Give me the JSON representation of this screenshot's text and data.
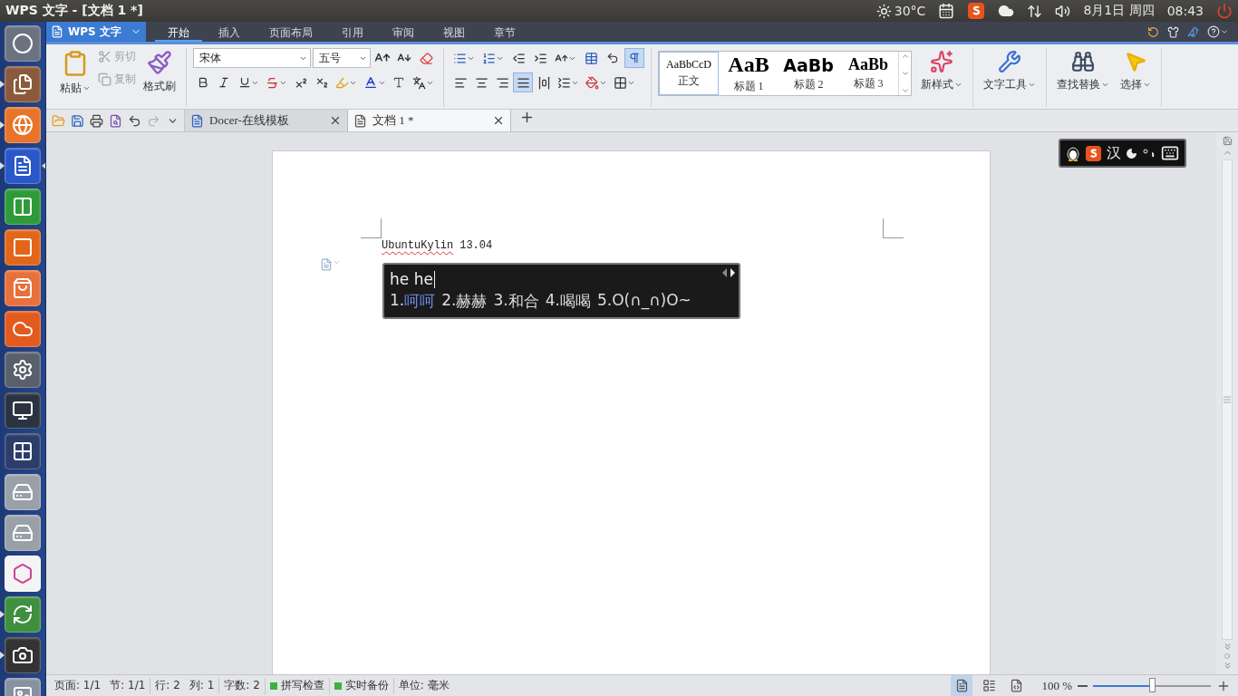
{
  "top_panel": {
    "title": "WPS 文字 - [文档 1 *]",
    "temperature": "30°C",
    "date": "8月1日 周四",
    "time": "08:43"
  },
  "launcher": {
    "items": [
      {
        "kind": "dash",
        "running": false
      },
      {
        "kind": "files",
        "running": true
      },
      {
        "kind": "browser",
        "running": true
      },
      {
        "kind": "writer",
        "running": true,
        "selected": true
      },
      {
        "kind": "spreadsheet",
        "running": false
      },
      {
        "kind": "presentation",
        "running": false
      },
      {
        "kind": "store",
        "running": false
      },
      {
        "kind": "cloud",
        "running": false
      },
      {
        "kind": "settings",
        "running": false
      },
      {
        "kind": "monitor",
        "running": false
      },
      {
        "kind": "workspaces",
        "running": false
      },
      {
        "kind": "disk",
        "running": false
      },
      {
        "kind": "disk",
        "running": false
      },
      {
        "kind": "palette",
        "running": false
      },
      {
        "kind": "updater",
        "running": true
      },
      {
        "kind": "webcam",
        "running": true
      },
      {
        "kind": "screenshot",
        "running": false
      }
    ]
  },
  "app_menu": {
    "label": "WPS 文字",
    "tabs": [
      {
        "label": "开始",
        "selected": true
      },
      {
        "label": "插入",
        "selected": false
      },
      {
        "label": "页面布局",
        "selected": false
      },
      {
        "label": "引用",
        "selected": false
      },
      {
        "label": "审阅",
        "selected": false
      },
      {
        "label": "视图",
        "selected": false
      },
      {
        "label": "章节",
        "selected": false
      }
    ]
  },
  "ribbon": {
    "paste": "粘贴",
    "cut": {
      "label": "剪切",
      "disabled": true
    },
    "copy": {
      "label": "复制",
      "disabled": true
    },
    "format_painter": "格式刷",
    "font_family": "宋体",
    "font_size": "五号",
    "show_marks": true,
    "alignments": [
      {
        "kind": "left",
        "selected": false
      },
      {
        "kind": "center",
        "selected": false
      },
      {
        "kind": "right",
        "selected": false
      },
      {
        "kind": "justify",
        "selected": true
      },
      {
        "kind": "distribute",
        "selected": false
      }
    ],
    "styles": [
      {
        "sample": "AaBbCcD",
        "name": "正文",
        "kind": "body",
        "selected": true
      },
      {
        "sample": "AaB",
        "name": "标题 1",
        "kind": "h1",
        "selected": false
      },
      {
        "sample": "AaBb",
        "name": "标题 2",
        "kind": "h2",
        "selected": false
      },
      {
        "sample": "AaBb",
        "name": "标题 3",
        "kind": "h3",
        "selected": false
      }
    ],
    "new_style": "新样式",
    "text_tools": "文字工具",
    "find_replace": "查找替换",
    "select": "选择"
  },
  "quick_access": [
    {
      "kind": "open",
      "disabled": false
    },
    {
      "kind": "save",
      "disabled": false
    },
    {
      "kind": "print",
      "disabled": false
    },
    {
      "kind": "preview",
      "disabled": false
    },
    {
      "kind": "undo",
      "disabled": false
    },
    {
      "kind": "redo",
      "disabled": true
    }
  ],
  "doc_tabs": [
    {
      "label": "Docer-在线模板",
      "selected": false
    },
    {
      "label": "文档 1 *",
      "selected": true
    }
  ],
  "document": {
    "words": [
      {
        "text": "UbuntuKylin",
        "misspelled": true
      },
      {
        "text": "13.04",
        "misspelled": false
      }
    ]
  },
  "ime_toolbar": {
    "mode": "汉"
  },
  "ime_candidates": {
    "composition": "he he",
    "candidates": [
      {
        "index": "1.",
        "text": "呵呵",
        "selected": true
      },
      {
        "index": "2.",
        "text": "赫赫",
        "selected": false
      },
      {
        "index": "3.",
        "text": "和合",
        "selected": false
      },
      {
        "index": "4.",
        "text": "喝喝",
        "selected": false
      },
      {
        "index": "5.",
        "text": "O(∩_∩)O~",
        "selected": false
      }
    ]
  },
  "status_bar": {
    "sections": [
      [
        "页面: 1/1",
        "节: 1/1"
      ],
      [
        "行: 2",
        "列: 1"
      ],
      [
        "字数: 2"
      ]
    ],
    "toggles": [
      {
        "label": "拼写检查",
        "on": true
      },
      {
        "label": "实时备份",
        "on": true
      }
    ],
    "unit": "单位: 毫米",
    "views": [
      {
        "kind": "page",
        "selected": true
      },
      {
        "kind": "outline",
        "selected": false
      },
      {
        "kind": "web",
        "selected": false
      }
    ],
    "zoom": "100 %",
    "zoom_slider": {
      "level": 0.5
    }
  }
}
